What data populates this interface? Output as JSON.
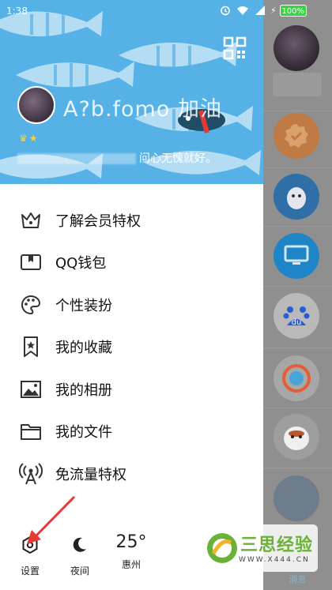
{
  "status_bar": {
    "time": "1:38",
    "battery_percent": "100%"
  },
  "profile": {
    "nickname": "A?b.fomo 加油",
    "signature": "问心无愧就好。"
  },
  "menu": [
    {
      "label": "了解会员特权",
      "icon": "crown-icon"
    },
    {
      "label": "QQ钱包",
      "icon": "wallet-icon"
    },
    {
      "label": "个性装扮",
      "icon": "palette-icon"
    },
    {
      "label": "我的收藏",
      "icon": "bookmark-star-icon"
    },
    {
      "label": "我的相册",
      "icon": "photo-icon"
    },
    {
      "label": "我的文件",
      "icon": "folder-icon"
    },
    {
      "label": "免流量特权",
      "icon": "signal-tower-icon"
    }
  ],
  "bottom_bar": {
    "settings_label": "设置",
    "night_label": "夜间",
    "weather_temp": "25°",
    "weather_city": "惠州"
  },
  "background_list": {
    "messages_tab_label": "消息"
  },
  "watermark": {
    "title": "三思经验",
    "url": "WWW.X444.CN"
  },
  "colors": {
    "hero_blue": "#56b2e6",
    "accent_red": "#e53935",
    "battery_green": "#37d640"
  }
}
